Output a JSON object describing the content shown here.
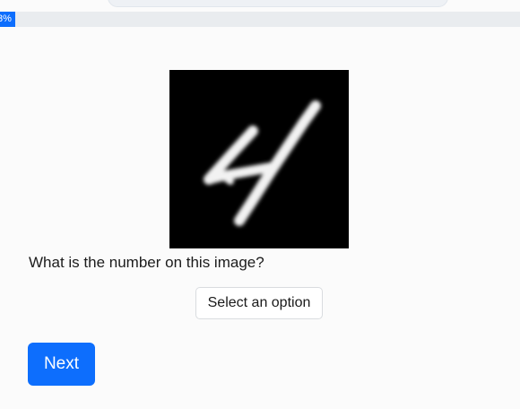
{
  "progress": {
    "label": "3%",
    "value_percent": 3
  },
  "digit_image": {
    "icon": "handwritten-digit-image"
  },
  "question": {
    "text": "What is the number on this image?"
  },
  "answer_select": {
    "selected_label": "Select an option"
  },
  "actions": {
    "next_label": "Next"
  },
  "colors": {
    "accent": "#0d6efd",
    "progress_track": "#e9ecef",
    "image_background": "#000000"
  }
}
